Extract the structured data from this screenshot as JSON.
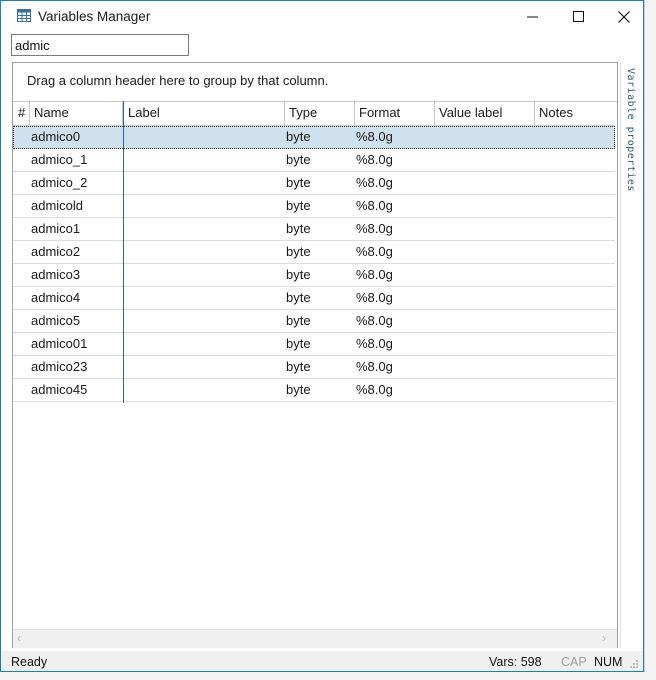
{
  "window": {
    "title": "Variables Manager"
  },
  "filter": {
    "value": "admic"
  },
  "grid": {
    "group_hint": "Drag a column header here to group by that column.",
    "columns": [
      "#",
      "Name",
      "Label",
      "Type",
      "Format",
      "Value label",
      "Notes"
    ],
    "rows": [
      {
        "name": "admico0",
        "label": "",
        "type": "byte",
        "format": "%8.0g",
        "selected": true
      },
      {
        "name": "admico_1",
        "label": "",
        "type": "byte",
        "format": "%8.0g"
      },
      {
        "name": "admico_2",
        "label": "",
        "type": "byte",
        "format": "%8.0g"
      },
      {
        "name": "admicold",
        "label": "",
        "type": "byte",
        "format": "%8.0g"
      },
      {
        "name": "admico1",
        "label": "",
        "type": "byte",
        "format": "%8.0g"
      },
      {
        "name": "admico2",
        "label": "",
        "type": "byte",
        "format": "%8.0g"
      },
      {
        "name": "admico3",
        "label": "",
        "type": "byte",
        "format": "%8.0g"
      },
      {
        "name": "admico4",
        "label": "",
        "type": "byte",
        "format": "%8.0g"
      },
      {
        "name": "admico5",
        "label": "",
        "type": "byte",
        "format": "%8.0g"
      },
      {
        "name": "admico01",
        "label": "",
        "type": "byte",
        "format": "%8.0g"
      },
      {
        "name": "admico23",
        "label": "",
        "type": "byte",
        "format": "%8.0g"
      },
      {
        "name": "admico45",
        "label": "",
        "type": "byte",
        "format": "%8.0g"
      }
    ]
  },
  "side_tab": {
    "label": "Variable properties"
  },
  "status": {
    "text": "Ready",
    "vars": "Vars: 598",
    "cap": "CAP",
    "num": "NUM"
  },
  "colors": {
    "accent_border": "#1e7fa8",
    "selection": "#cfe0ef",
    "side_text": "#2d5b7c"
  }
}
